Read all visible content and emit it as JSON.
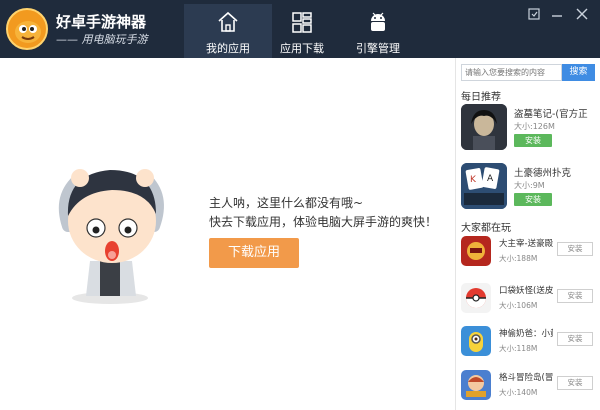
{
  "app": {
    "title": "好卓手游神器",
    "slogan": "—— 用电脑玩手游"
  },
  "nav": {
    "tabs": [
      {
        "label": "我的应用",
        "icon": "home-icon",
        "active": true
      },
      {
        "label": "应用下载",
        "icon": "grid-icon",
        "active": false
      },
      {
        "label": "引擎管理",
        "icon": "android-icon",
        "active": false
      }
    ]
  },
  "window_controls": [
    "settings-icon",
    "minimize-icon",
    "close-icon"
  ],
  "main": {
    "empty_line1": "主人呐，这里什么都没有哦~",
    "empty_line2": "快去下载应用，体验电脑大屏手游的爽快！",
    "download_button": "下载应用"
  },
  "sidebar": {
    "search_placeholder": "请输入您要搜索的内容",
    "search_button": "搜索",
    "daily_title": "每日推荐",
    "daily": [
      {
        "name": "盗墓笔记-(官方正",
        "size": "大小:126M",
        "install": "安装",
        "icon_color": "#3a3f4b"
      },
      {
        "name": "土豪德州扑克",
        "size": "大小:9M",
        "install": "安装",
        "icon_color": "#2d5a8c"
      }
    ],
    "playing_title": "大家都在玩",
    "playing": [
      {
        "name": "大主宰-送豪殿红",
        "size": "大小:188M",
        "install": "安装",
        "icon_color": "#b5271e"
      },
      {
        "name": "口袋妖怪(送皮卡",
        "size": "大小:106M",
        "install": "安装",
        "icon_color": "#e23a2f"
      },
      {
        "name": "神偷奶爸：小黄",
        "size": "大小:118M",
        "install": "安装",
        "icon_color": "#3b8fd8"
      },
      {
        "name": "格斗冒险岛(冒险",
        "size": "大小:140M",
        "install": "安装",
        "icon_color": "#c04a2a"
      }
    ]
  },
  "colors": {
    "header_bg": "#1f2b3c",
    "accent_orange": "#f29a4a",
    "install_green": "#5cb85c",
    "search_blue": "#3f8ce3"
  }
}
